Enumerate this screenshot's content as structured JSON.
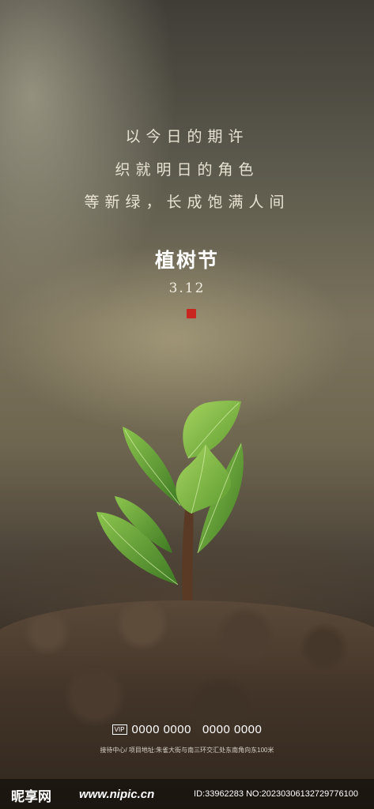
{
  "poem": [
    "以今日的期许",
    "织就明日的角色",
    "等新绿，长成饱满人间"
  ],
  "festival": {
    "title": "植树节",
    "date": "3.12"
  },
  "contact": {
    "vip_icon_text": "VIP",
    "phone_1": "0000 0000",
    "phone_2": "0000 0000",
    "address": "接待中心/ 项目地址:朱雀大街与南三环交汇处东南角向东100米"
  },
  "watermark": {
    "logo": "昵享网",
    "url": "www.nipic.cn",
    "id": "ID:33962283 NO:20230306132729776100"
  },
  "colors": {
    "seal": "#c9261f",
    "leaf": "#6fae3a"
  }
}
